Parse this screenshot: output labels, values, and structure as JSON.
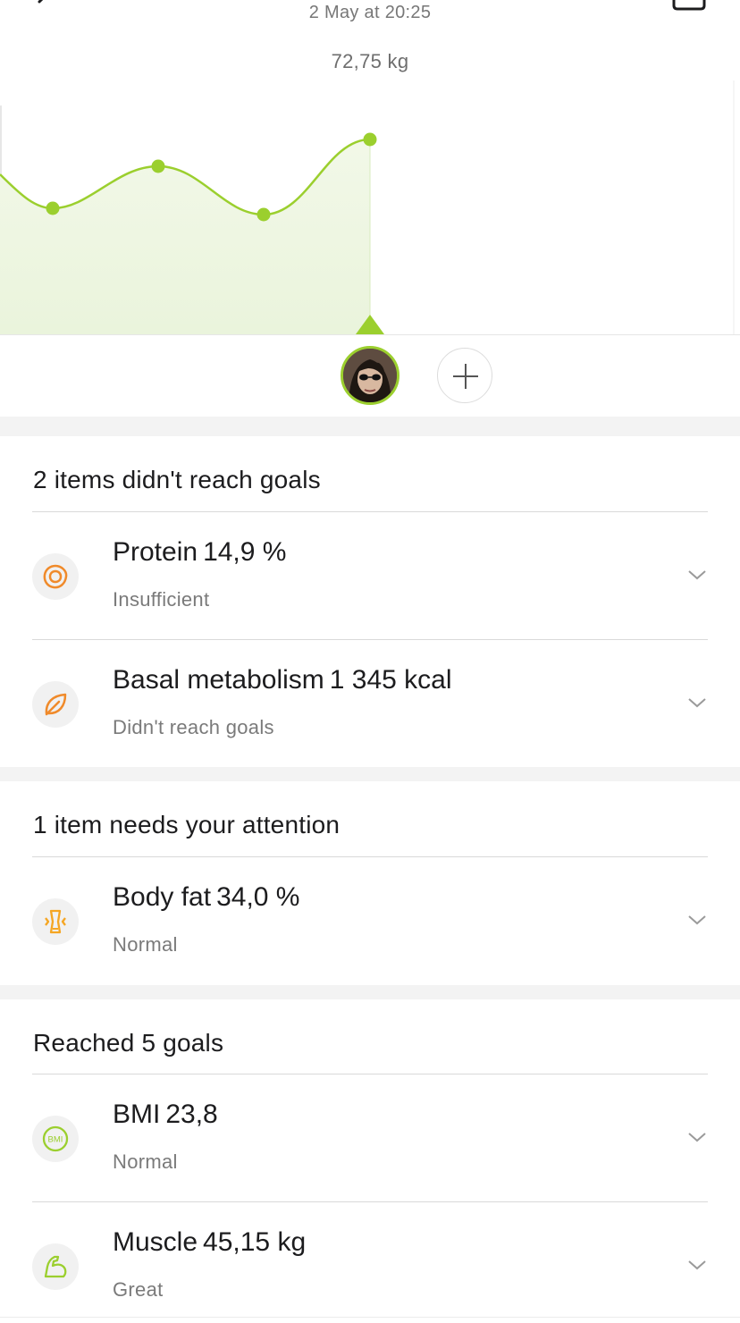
{
  "header": {
    "date": "2 May at 20:25",
    "weight": "72,75 kg"
  },
  "colors": {
    "accent": "#9bcf2e",
    "orange": "#f08a2a",
    "amber": "#f5a623",
    "icon_bg": "#f1f1f1"
  },
  "icons": {
    "back": "chevron-left-icon",
    "calendar": "calendar-icon",
    "add": "plus-icon"
  },
  "sections": [
    {
      "title": "2 items didn't reach goals",
      "items": [
        {
          "icon": "protein-icon",
          "label": "Protein",
          "value": "14,9 %",
          "status": "Insufficient"
        },
        {
          "icon": "leaf-icon",
          "label": "Basal metabolism",
          "value": "1 345 kcal",
          "status": "Didn't reach goals"
        }
      ]
    },
    {
      "title": "1 item needs your attention",
      "items": [
        {
          "icon": "body-fat-icon",
          "label": "Body fat",
          "value": "34,0 %",
          "status": "Normal"
        }
      ]
    },
    {
      "title": "Reached 5 goals",
      "items": [
        {
          "icon": "bmi-icon",
          "label": "BMI",
          "value": "23,8",
          "status": "Normal",
          "badge": "BMI"
        },
        {
          "icon": "muscle-icon",
          "label": "Muscle",
          "value": "45,15 kg",
          "status": "Great"
        }
      ]
    }
  ]
}
